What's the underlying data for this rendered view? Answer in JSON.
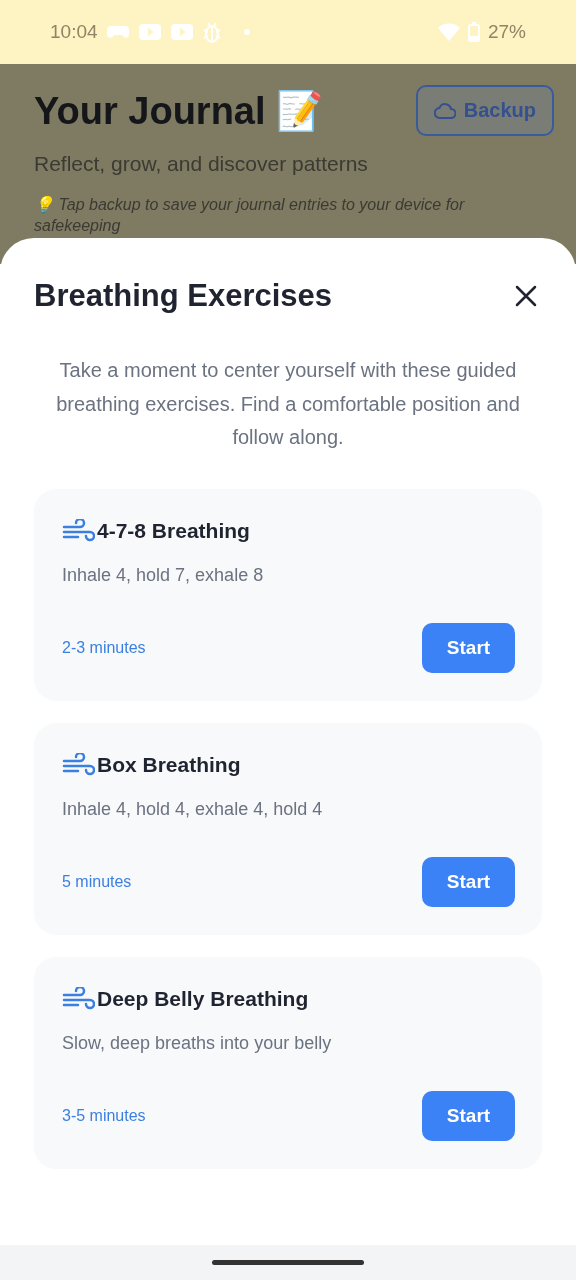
{
  "status_bar": {
    "time": "10:04",
    "battery": "27%"
  },
  "header": {
    "title": "Your Journal 📝",
    "backup_button": "Backup",
    "subtitle": "Reflect, grow, and discover patterns",
    "tip": "💡 Tap backup to save your journal entries to your device for safekeeping"
  },
  "sheet": {
    "title": "Breathing Exercises",
    "intro": "Take a moment to center yourself with these guided breathing exercises. Find a comfortable position and follow along.",
    "exercises": [
      {
        "name": "4-7-8 Breathing",
        "pattern": "Inhale 4, hold 7, exhale 8",
        "duration": "2-3 minutes",
        "button": "Start"
      },
      {
        "name": "Box Breathing",
        "pattern": "Inhale 4, hold 4, exhale 4, hold 4",
        "duration": "5 minutes",
        "button": "Start"
      },
      {
        "name": "Deep Belly Breathing",
        "pattern": "Slow, deep breaths into your belly",
        "duration": "3-5 minutes",
        "button": "Start"
      }
    ]
  }
}
